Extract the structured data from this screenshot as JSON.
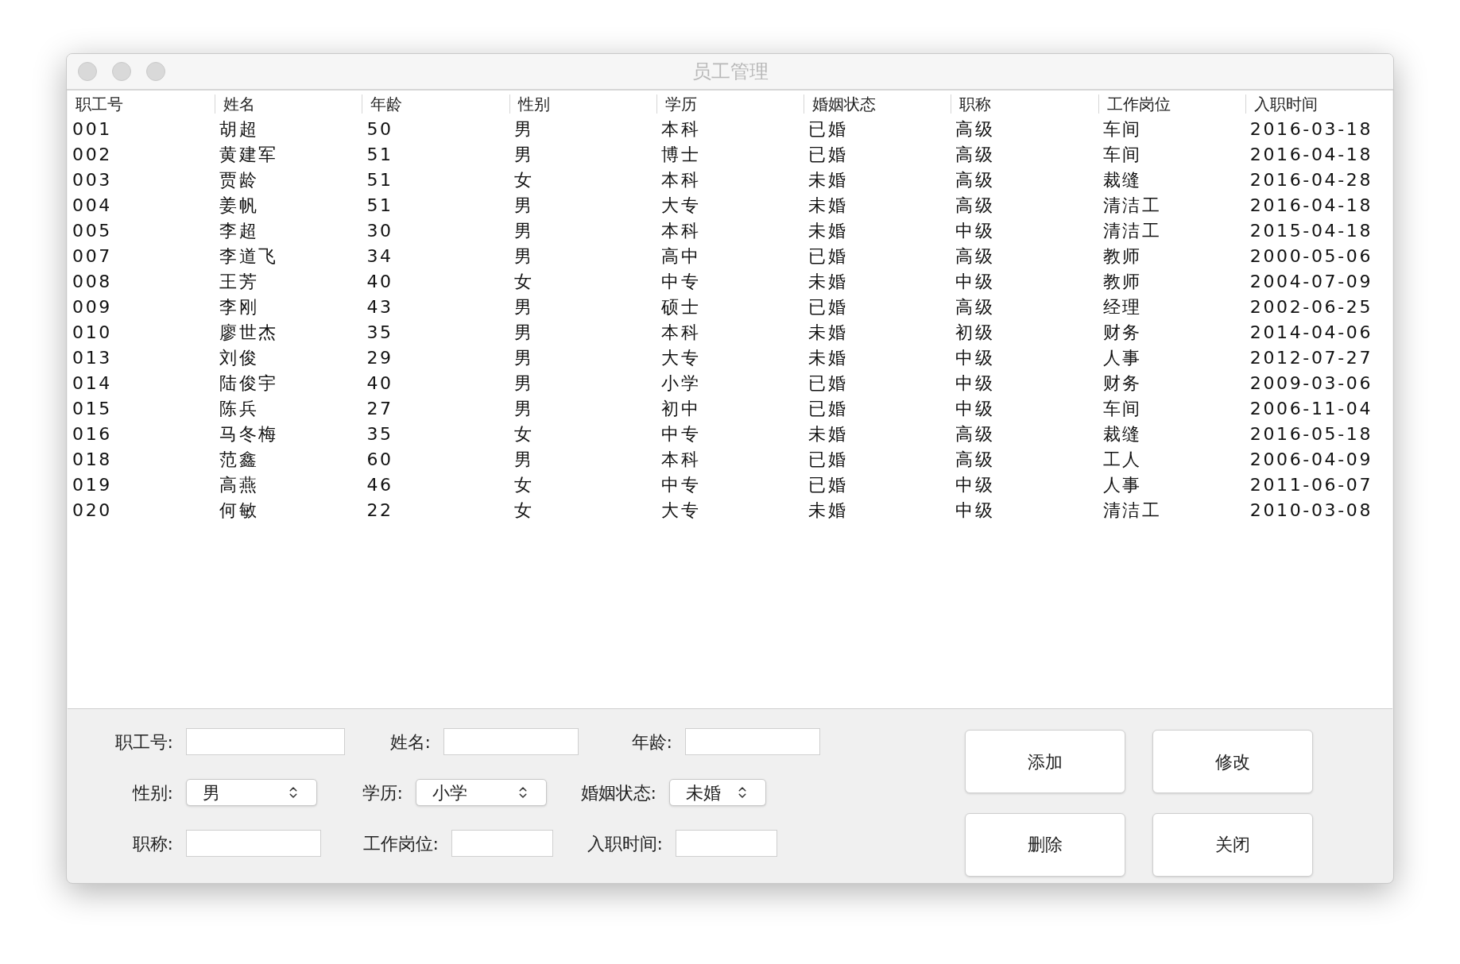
{
  "window": {
    "title": "员工管理"
  },
  "table": {
    "columns": [
      "职工号",
      "姓名",
      "年龄",
      "性别",
      "学历",
      "婚姻状态",
      "职称",
      "工作岗位",
      "入职时间"
    ],
    "rows": [
      [
        "001",
        "胡超",
        "50",
        "男",
        "本科",
        "已婚",
        "高级",
        "车间",
        "2016-03-18"
      ],
      [
        "002",
        "黄建军",
        "51",
        "男",
        "博士",
        "已婚",
        "高级",
        "车间",
        "2016-04-18"
      ],
      [
        "003",
        "贾龄",
        "51",
        "女",
        "本科",
        "未婚",
        "高级",
        "裁缝",
        "2016-04-28"
      ],
      [
        "004",
        "姜帆",
        "51",
        "男",
        "大专",
        "未婚",
        "高级",
        "清洁工",
        "2016-04-18"
      ],
      [
        "005",
        "李超",
        "30",
        "男",
        "本科",
        "未婚",
        "中级",
        "清洁工",
        "2015-04-18"
      ],
      [
        "007",
        "李道飞",
        "34",
        "男",
        "高中",
        "已婚",
        "高级",
        "教师",
        "2000-05-06"
      ],
      [
        "008",
        "王芳",
        "40",
        "女",
        "中专",
        "未婚",
        "中级",
        "教师",
        "2004-07-09"
      ],
      [
        "009",
        "李刚",
        "43",
        "男",
        "硕士",
        "已婚",
        "高级",
        "经理",
        "2002-06-25"
      ],
      [
        "010",
        "廖世杰",
        "35",
        "男",
        "本科",
        "未婚",
        "初级",
        "财务",
        "2014-04-06"
      ],
      [
        "013",
        "刘俊",
        "29",
        "男",
        "大专",
        "未婚",
        "中级",
        "人事",
        "2012-07-27"
      ],
      [
        "014",
        "陆俊宇",
        "40",
        "男",
        "小学",
        "已婚",
        "中级",
        "财务",
        "2009-03-06"
      ],
      [
        "015",
        "陈兵",
        "27",
        "男",
        "初中",
        "已婚",
        "中级",
        "车间",
        "2006-11-04"
      ],
      [
        "016",
        "马冬梅",
        "35",
        "女",
        "中专",
        "未婚",
        "高级",
        "裁缝",
        "2016-05-18"
      ],
      [
        "018",
        "范鑫",
        "60",
        "男",
        "本科",
        "已婚",
        "高级",
        "工人",
        "2006-04-09"
      ],
      [
        "019",
        "高燕",
        "46",
        "女",
        "中专",
        "已婚",
        "中级",
        "人事",
        "2011-06-07"
      ],
      [
        "020",
        "何敏",
        "22",
        "女",
        "大专",
        "未婚",
        "中级",
        "清洁工",
        "2010-03-08"
      ]
    ]
  },
  "form": {
    "rows": [
      [
        {
          "label": "职工号:",
          "kind": "text"
        },
        {
          "label": "姓名:",
          "kind": "text"
        },
        {
          "label": "年龄:",
          "kind": "text"
        }
      ],
      [
        {
          "label": "性别:",
          "kind": "select",
          "value": "男"
        },
        {
          "label": "学历:",
          "kind": "select",
          "value": "小学"
        },
        {
          "label": "婚姻状态:",
          "kind": "select",
          "value": "未婚"
        }
      ],
      [
        {
          "label": "职称:",
          "kind": "text"
        },
        {
          "label": "工作岗位:",
          "kind": "text"
        },
        {
          "label": "入职时间:",
          "kind": "text"
        }
      ]
    ]
  },
  "buttons": [
    "添加",
    "修改",
    "删除",
    "关闭"
  ]
}
